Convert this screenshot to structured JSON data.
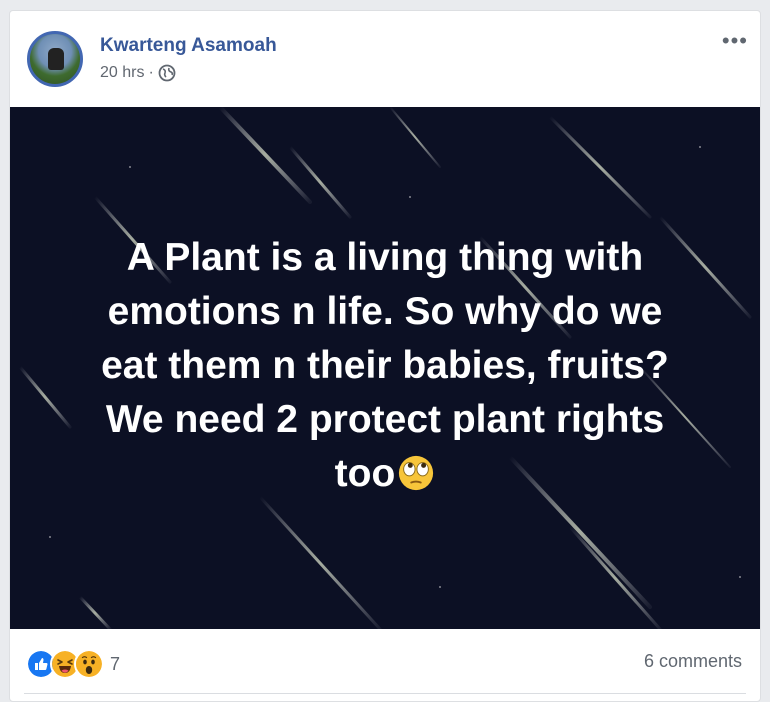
{
  "post": {
    "author": "Kwarteng Asamoah",
    "time": "20 hrs",
    "separator": "·",
    "privacy_icon": "globe-icon",
    "more_label": "•••",
    "image_text": "A Plant is a living thing with\nemotions n life. So why do we\neat them n their babies, fruits?\nWe need 2 protect plant rights\ntoo",
    "image_emoji": "face-with-rolling-eyes-emoji"
  },
  "footer": {
    "reactions": [
      "like",
      "haha",
      "wow"
    ],
    "reaction_count": "7",
    "comments": "6 comments"
  },
  "colors": {
    "author": "#385898",
    "like_blue": "#1877f2",
    "reaction_yellow": "#f7b125",
    "image_bg": "#0c1024",
    "page_bg": "#e9ebee"
  }
}
